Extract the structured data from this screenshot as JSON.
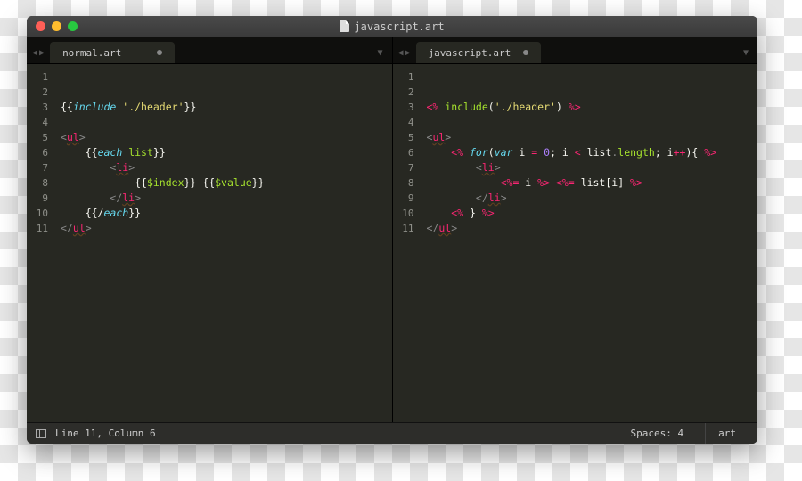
{
  "window": {
    "title": "javascript.art"
  },
  "panes": [
    {
      "tab": "normal.art",
      "modified": true,
      "lines": [
        [],
        [],
        [
          [
            "delim",
            "{{"
          ],
          [
            "kw",
            "include"
          ],
          [
            "delim",
            " "
          ],
          [
            "str",
            "'./header'"
          ],
          [
            "delim",
            "}}"
          ]
        ],
        [],
        [
          [
            "punct",
            "<"
          ],
          [
            "tag",
            "ul",
            "u"
          ],
          [
            "punct",
            ">"
          ]
        ],
        [
          [
            "indent",
            1
          ],
          [
            "delim",
            "{{"
          ],
          [
            "kw",
            "each"
          ],
          [
            "delim",
            " "
          ],
          [
            "var",
            "list"
          ],
          [
            "delim",
            "}}"
          ]
        ],
        [
          [
            "indent",
            2
          ],
          [
            "punct",
            "<"
          ],
          [
            "tag",
            "li",
            "u"
          ],
          [
            "punct",
            ">"
          ]
        ],
        [
          [
            "indent",
            3
          ],
          [
            "delim",
            "{{"
          ],
          [
            "var",
            "$index"
          ],
          [
            "delim",
            "}} {{"
          ],
          [
            "var",
            "$value"
          ],
          [
            "delim",
            "}}"
          ]
        ],
        [
          [
            "indent",
            2
          ],
          [
            "punct",
            "</"
          ],
          [
            "tag",
            "li",
            "u"
          ],
          [
            "punct",
            ">"
          ]
        ],
        [
          [
            "indent",
            1
          ],
          [
            "delim",
            "{{/"
          ],
          [
            "kw",
            "each"
          ],
          [
            "delim",
            "}}"
          ]
        ],
        [
          [
            "punct",
            "</"
          ],
          [
            "tag",
            "ul",
            "u"
          ],
          [
            "punct",
            ">"
          ]
        ]
      ]
    },
    {
      "tab": "javascript.art",
      "modified": true,
      "lines": [
        [],
        [],
        [
          [
            "op",
            "<% "
          ],
          [
            "var",
            "include"
          ],
          [
            "delim",
            "("
          ],
          [
            "str",
            "'./header'"
          ],
          [
            "delim",
            ") "
          ],
          [
            "op",
            "%>"
          ]
        ],
        [],
        [
          [
            "punct",
            "<"
          ],
          [
            "tag",
            "ul",
            "u"
          ],
          [
            "punct",
            ">"
          ]
        ],
        [
          [
            "indent",
            1
          ],
          [
            "op",
            "<% "
          ],
          [
            "kw",
            "for"
          ],
          [
            "delim",
            "("
          ],
          [
            "kw",
            "var"
          ],
          [
            "delim",
            " i "
          ],
          [
            "op",
            "="
          ],
          [
            "delim",
            " "
          ],
          [
            "num",
            "0"
          ],
          [
            "delim",
            "; i "
          ],
          [
            "op",
            "<"
          ],
          [
            "delim",
            " list"
          ],
          [
            "punct",
            "."
          ],
          [
            "var",
            "length"
          ],
          [
            "delim",
            "; i"
          ],
          [
            "op",
            "++"
          ],
          [
            "delim",
            "){ "
          ],
          [
            "op",
            "%>"
          ]
        ],
        [
          [
            "indent",
            2
          ],
          [
            "punct",
            "<"
          ],
          [
            "tag",
            "li",
            "u"
          ],
          [
            "punct",
            ">"
          ]
        ],
        [
          [
            "indent",
            3
          ],
          [
            "op",
            "<%="
          ],
          [
            "delim",
            " i "
          ],
          [
            "op",
            "%>"
          ],
          [
            "delim",
            " "
          ],
          [
            "op",
            "<%="
          ],
          [
            "delim",
            " list[i] "
          ],
          [
            "op",
            "%>"
          ]
        ],
        [
          [
            "indent",
            2
          ],
          [
            "punct",
            "</"
          ],
          [
            "tag",
            "li",
            "u"
          ],
          [
            "punct",
            ">"
          ]
        ],
        [
          [
            "indent",
            1
          ],
          [
            "op",
            "<% "
          ],
          [
            "delim",
            "} "
          ],
          [
            "op",
            "%>"
          ]
        ],
        [
          [
            "punct",
            "</"
          ],
          [
            "tag",
            "ul",
            "u"
          ],
          [
            "punct",
            ">"
          ]
        ]
      ]
    }
  ],
  "statusbar": {
    "position": "Line 11, Column 6",
    "spaces": "Spaces: 4",
    "syntax": "art"
  }
}
